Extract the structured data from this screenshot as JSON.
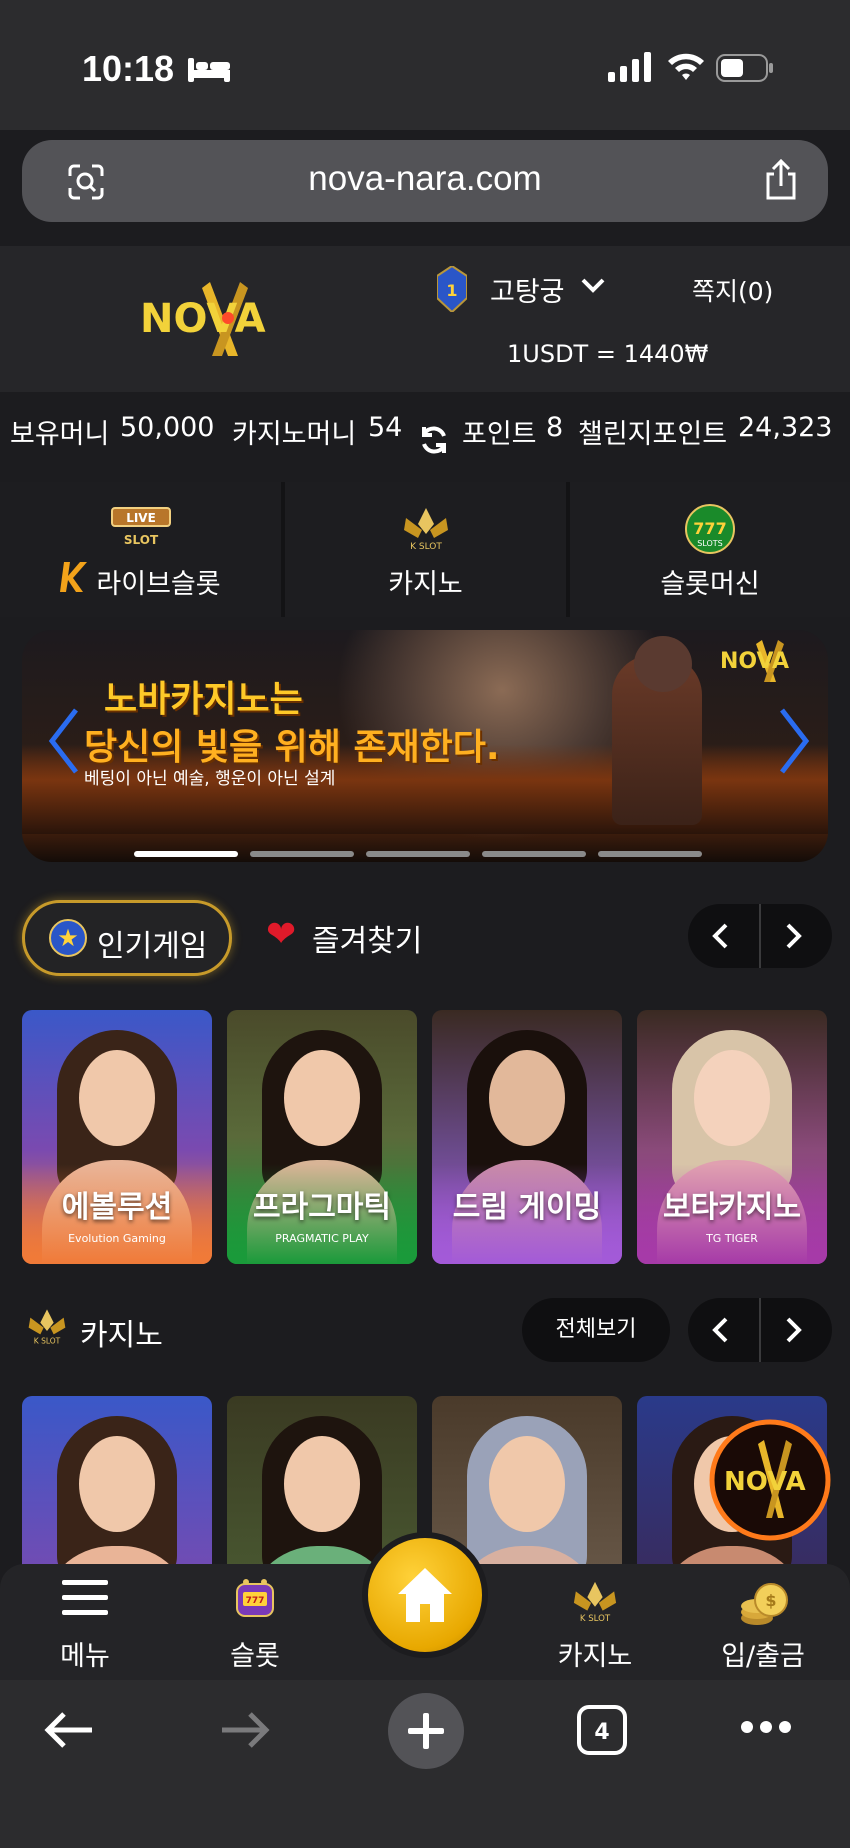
{
  "status_bar": {
    "time": "10:18"
  },
  "browser": {
    "url": "nova-nara.com",
    "tabs_count": "4"
  },
  "header": {
    "logo_text": "NOVA",
    "level": "1",
    "username": "고탕궁",
    "messages": "쪽지(0)",
    "exchange_rate": "1USDT = 1440₩"
  },
  "balance": {
    "holding_label": "보유머니",
    "holding_value": "50,000",
    "casino_label": "카지노머니",
    "casino_value": "54",
    "point_label": "포인트",
    "point_value": "8",
    "challenge_label": "챌린지포인트",
    "challenge_value": "24,323"
  },
  "categories": [
    {
      "label": "라이브슬롯",
      "icon": "live-slot-icon"
    },
    {
      "label": "카지노",
      "icon": "k-slot-icon"
    },
    {
      "label": "슬롯머신",
      "icon": "slots-777-icon"
    }
  ],
  "banner": {
    "line1": "노바카지노는",
    "line2": "당신의 빛을 위해 존재한다.",
    "subtitle": "베팅이 아닌 예술, 행운이 아닌 설계",
    "logo": "NOVA",
    "active_slide": 1,
    "slides_total": 5
  },
  "popular": {
    "tab_popular": "인기게임",
    "tab_favorites": "즐겨찾기"
  },
  "popular_cards": [
    {
      "title": "에볼루션",
      "provider": "Evolution Gaming"
    },
    {
      "title": "프라그마틱",
      "provider": "PRAGMATIC PLAY"
    },
    {
      "title": "드림 게이밍",
      "provider": ""
    },
    {
      "title": "보타카지노",
      "provider": "TG TIGER"
    }
  ],
  "casino_section": {
    "title": "카지노",
    "view_all": "전체보기",
    "badge_logo": "NOVA"
  },
  "bottom_nav": [
    {
      "label": "메뉴",
      "icon": "menu-icon"
    },
    {
      "label": "슬롯",
      "icon": "slot-machine-icon"
    },
    {
      "label": "",
      "icon": "home-icon"
    },
    {
      "label": "카지노",
      "icon": "k-slot-icon"
    },
    {
      "label": "입/출금",
      "icon": "coins-icon"
    }
  ],
  "colors": {
    "accent_gold": "#e8a800",
    "bg": "#1c1c1f",
    "banner_text": "#ffc928"
  }
}
